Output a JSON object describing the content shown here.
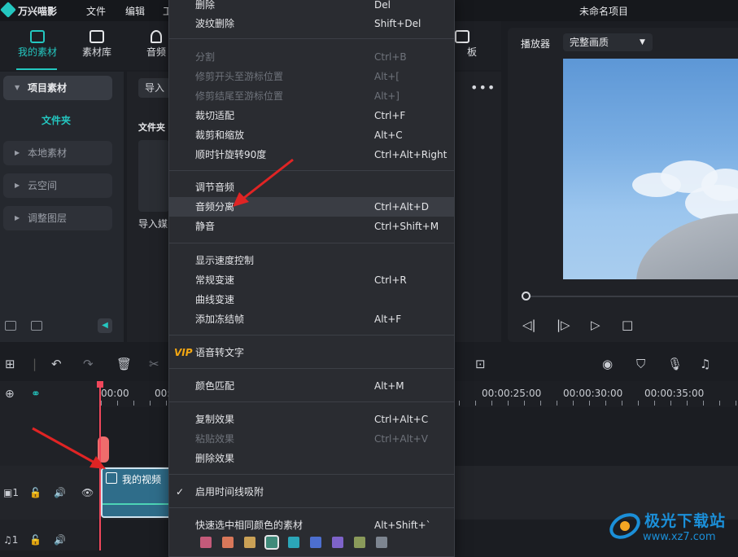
{
  "titlebar": {
    "app_name": "万兴喵影",
    "menus": [
      "文件",
      "编辑",
      "工"
    ],
    "project_title": "未命名项目"
  },
  "toolbar": {
    "tabs": [
      {
        "label": "我的素材",
        "icon": "media-icon",
        "active": true
      },
      {
        "label": "素材库",
        "icon": "library-icon",
        "active": false
      },
      {
        "label": "音频",
        "icon": "music-icon",
        "active": false
      },
      {
        "label": "板",
        "icon": "template-icon",
        "active": false
      }
    ]
  },
  "sidebar": {
    "items": [
      "项目素材",
      "本地素材",
      "云空间",
      "调整图层"
    ],
    "folder_label": "文件夹"
  },
  "media": {
    "import_label": "导入",
    "folder_heading": "文件夹",
    "import_media_text": "导入媒"
  },
  "player": {
    "label": "播放器",
    "quality": "完整画质"
  },
  "timeline": {
    "timestamps": [
      "00:00",
      "00:0",
      "00:00:25:00",
      "00:00:30:00",
      "00:00:35:00"
    ],
    "clip_title": "我的视频",
    "track_video_num": "1",
    "track_audio_num": "1"
  },
  "context_menu": {
    "sections": [
      [
        {
          "label": "删除",
          "shortcut": "Del",
          "disabled": false
        },
        {
          "label": "波纹删除",
          "shortcut": "Shift+Del",
          "disabled": false
        }
      ],
      [
        {
          "label": "分割",
          "shortcut": "Ctrl+B",
          "disabled": true
        },
        {
          "label": "修剪开头至游标位置",
          "shortcut": "Alt+[",
          "disabled": true
        },
        {
          "label": "修剪结尾至游标位置",
          "shortcut": "Alt+]",
          "disabled": true
        },
        {
          "label": "裁切适配",
          "shortcut": "Ctrl+F",
          "disabled": false
        },
        {
          "label": "裁剪和缩放",
          "shortcut": "Alt+C",
          "disabled": false
        },
        {
          "label": "顺时针旋转90度",
          "shortcut": "Ctrl+Alt+Right",
          "disabled": false
        }
      ],
      [
        {
          "label": "调节音频",
          "shortcut": "",
          "disabled": false
        },
        {
          "label": "音频分离",
          "shortcut": "Ctrl+Alt+D",
          "disabled": false,
          "highlighted": true
        },
        {
          "label": "静音",
          "shortcut": "Ctrl+Shift+M",
          "disabled": false
        }
      ],
      [
        {
          "label": "显示速度控制",
          "shortcut": "",
          "disabled": false
        },
        {
          "label": "常规变速",
          "shortcut": "Ctrl+R",
          "disabled": false
        },
        {
          "label": "曲线变速",
          "shortcut": "",
          "disabled": false
        },
        {
          "label": "添加冻结帧",
          "shortcut": "Alt+F",
          "disabled": false
        }
      ],
      [
        {
          "label": "语音转文字",
          "shortcut": "",
          "disabled": false,
          "vip": "VIP"
        }
      ],
      [
        {
          "label": "颜色匹配",
          "shortcut": "Alt+M",
          "disabled": false
        }
      ],
      [
        {
          "label": "复制效果",
          "shortcut": "Ctrl+Alt+C",
          "disabled": false
        },
        {
          "label": "粘贴效果",
          "shortcut": "Ctrl+Alt+V",
          "disabled": true
        },
        {
          "label": "删除效果",
          "shortcut": "",
          "disabled": false
        }
      ],
      [
        {
          "label": "启用时间线吸附",
          "shortcut": "",
          "disabled": false,
          "checked": true
        }
      ],
      [
        {
          "label": "快速选中相同颜色的素材",
          "shortcut": "Alt+Shift+`",
          "disabled": false
        }
      ]
    ],
    "color_swatches": [
      "#c45a7a",
      "#d9785a",
      "#caa156",
      "#3f8a7a",
      "#2ba6b8",
      "#4d6fd0",
      "#7e63c9",
      "#8a9a5a",
      "#7d8590"
    ]
  },
  "watermark": {
    "title": "极光下载站",
    "url": "www.xz7.com"
  },
  "colors": {
    "accent": "#24c7c0",
    "annotation_arrow": "#e02424"
  }
}
